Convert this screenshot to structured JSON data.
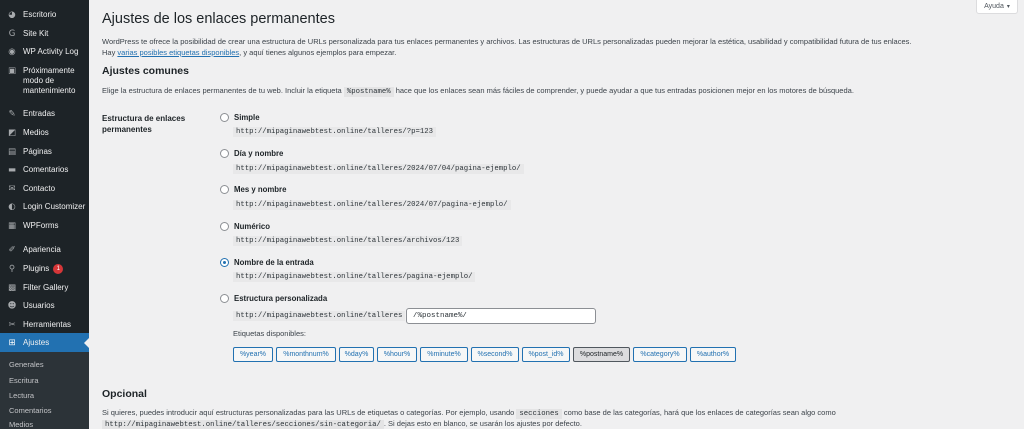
{
  "sidebar": {
    "items": [
      {
        "label": "Escritorio",
        "icon": "dashboard-icon",
        "glyph": "◕"
      },
      {
        "label": "Site Kit",
        "icon": "sitekit-icon",
        "glyph": "G"
      },
      {
        "label": "WP Activity Log",
        "icon": "activity-log-icon",
        "glyph": "◉"
      },
      {
        "label": "Próximamente modo de mantenimiento",
        "icon": "maintenance-icon",
        "glyph": "▣"
      },
      {
        "label": "Entradas",
        "icon": "pin-icon",
        "glyph": "✎"
      },
      {
        "label": "Medios",
        "icon": "media-icon",
        "glyph": "◩"
      },
      {
        "label": "Páginas",
        "icon": "pages-icon",
        "glyph": "▤"
      },
      {
        "label": "Comentarios",
        "icon": "comments-icon",
        "glyph": "▬"
      },
      {
        "label": "Contacto",
        "icon": "mail-icon",
        "glyph": "✉"
      },
      {
        "label": "Login Customizer",
        "icon": "login-customizer-icon",
        "glyph": "◐"
      },
      {
        "label": "WPForms",
        "icon": "forms-icon",
        "glyph": "▦"
      },
      {
        "label": "Apariencia",
        "icon": "brush-icon",
        "glyph": "✐"
      },
      {
        "label": "Plugins",
        "icon": "plugin-icon",
        "glyph": "⚲",
        "badge": "1"
      },
      {
        "label": "Filter Gallery",
        "icon": "gallery-icon",
        "glyph": "▩"
      },
      {
        "label": "Usuarios",
        "icon": "users-icon",
        "glyph": "☻"
      },
      {
        "label": "Herramientas",
        "icon": "tools-icon",
        "glyph": "✂"
      },
      {
        "label": "Ajustes",
        "icon": "settings-icon",
        "glyph": "⊞"
      }
    ],
    "submenu": [
      "Generales",
      "Escritura",
      "Lectura",
      "Comentarios",
      "Medios"
    ]
  },
  "help": {
    "label": "Ayuda",
    "caret": "▾"
  },
  "page": {
    "title": "Ajustes de los enlaces permanentes",
    "intro_text": "WordPress te ofrece la posibilidad de crear una estructura de URLs personalizada para tus enlaces permanentes y archivos. Las estructuras de URLs personalizadas pueden mejorar la estética, usabilidad y compatibilidad futura de tus enlaces. Hay ",
    "intro_link": "varias posibles etiquetas disponibles",
    "intro_tail": ", y aquí tienes algunos ejemplos para empezar."
  },
  "common": {
    "heading": "Ajustes comunes",
    "desc_before": "Elige la estructura de enlaces permanentes de tu web. Incluir la etiqueta ",
    "desc_code": "%postname%",
    "desc_after": " hace que los enlaces sean más fáciles de comprender, y puede ayudar a que tus entradas posicionen mejor en los motores de búsqueda.",
    "field_label": "Estructura de enlaces permanentes",
    "options": [
      {
        "label": "Simple",
        "url": "http://mipaginawebtest.online/talleres/?p=123",
        "checked": false
      },
      {
        "label": "Día y nombre",
        "url": "http://mipaginawebtest.online/talleres/2024/07/04/pagina-ejemplo/",
        "checked": false
      },
      {
        "label": "Mes y nombre",
        "url": "http://mipaginawebtest.online/talleres/2024/07/pagina-ejemplo/",
        "checked": false
      },
      {
        "label": "Numérico",
        "url": "http://mipaginawebtest.online/talleres/archivos/123",
        "checked": false
      },
      {
        "label": "Nombre de la entrada",
        "url": "http://mipaginawebtest.online/talleres/pagina-ejemplo/",
        "checked": true
      },
      {
        "label": "Estructura personalizada",
        "url": "http://mipaginawebtest.online/talleres",
        "checked": false
      }
    ],
    "custom_value": "/%postname%/",
    "tags_label": "Etiquetas disponibles:",
    "tags": [
      "%year%",
      "%monthnum%",
      "%day%",
      "%hour%",
      "%minute%",
      "%second%",
      "%post_id%",
      "%postname%",
      "%category%",
      "%author%"
    ],
    "pressed_tag": "%postname%"
  },
  "optional": {
    "heading": "Opcional",
    "text_before": "Si quieres, puedes introducir aquí estructuras personalizadas para las URLs de etiquetas o categorías. Por ejemplo, usando ",
    "text_code": "secciones",
    "text_after": " como base de las categorías, hará que los enlaces de categorías sean algo como",
    "example_code": "http://mipaginawebtest.online/talleres/secciones/sin-categoria/",
    "example_tail": ". Si dejas esto en blanco, se usarán los ajustes por defecto."
  },
  "colors": {
    "sidebar": "#1d2327",
    "accent": "#2271b1",
    "badge": "#d63638",
    "background": "#f0f0f1"
  }
}
